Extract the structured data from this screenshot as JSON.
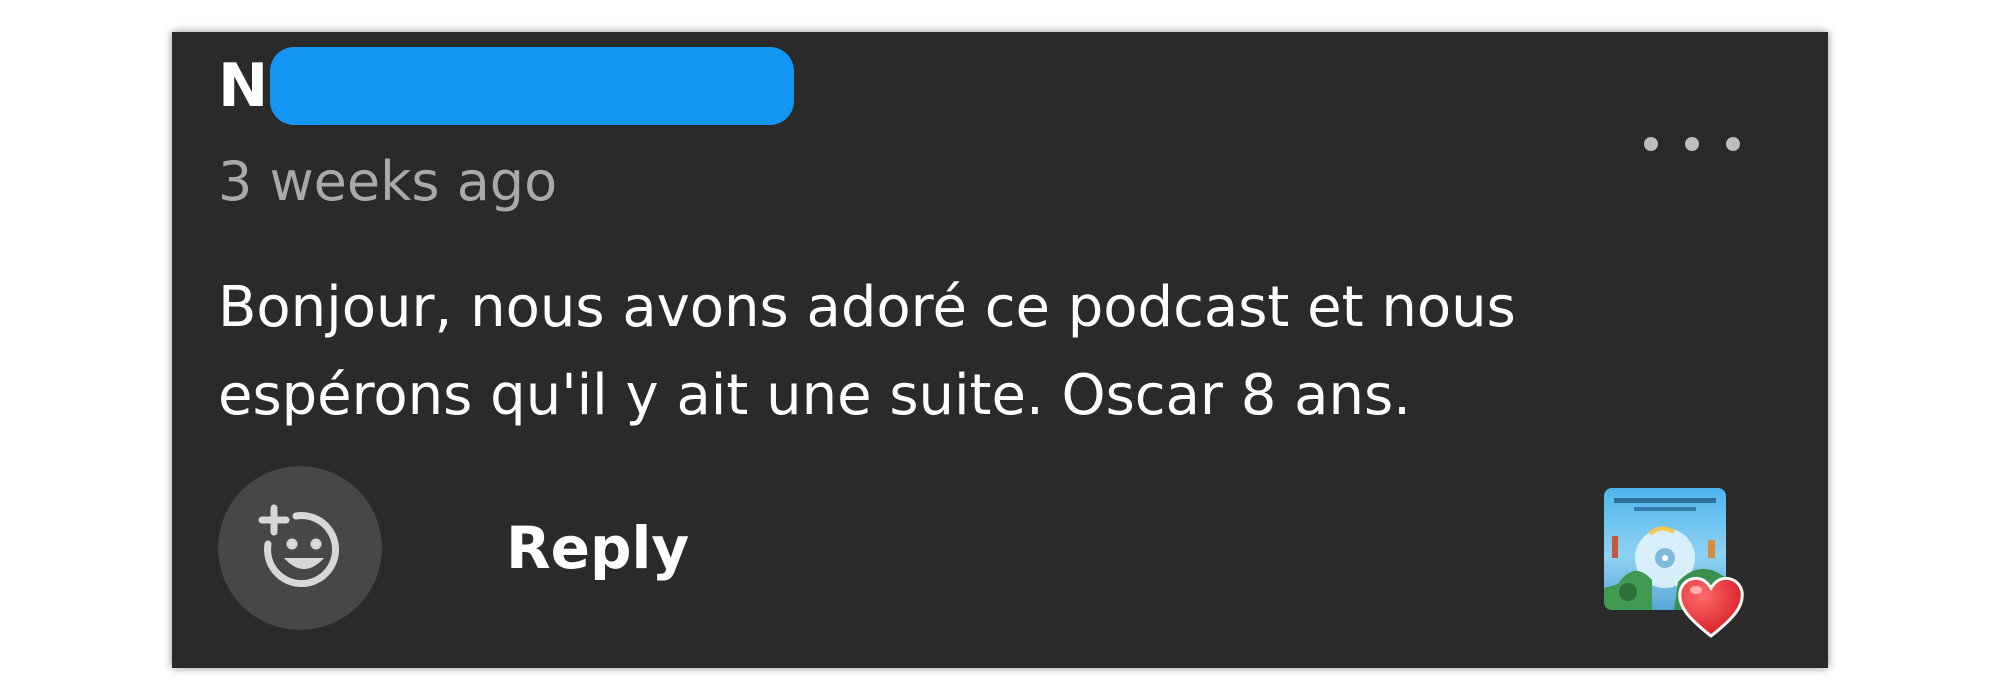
{
  "comment": {
    "author_initial": "N",
    "timestamp": "3 weeks ago",
    "text": "Bonjour, nous avons adoré ce podcast et nous espérons qu'il y ait une suite. Oscar 8 ans.",
    "reply_label": "Reply"
  },
  "icons": {
    "more": "more-options-icon",
    "react": "add-reaction-icon",
    "liked_by_creator": "heart-icon"
  },
  "colors": {
    "card_background": "#2a2a2a",
    "redaction": "#1395f3",
    "timestamp": "#a9a9a9",
    "heart": "#e0252c"
  }
}
